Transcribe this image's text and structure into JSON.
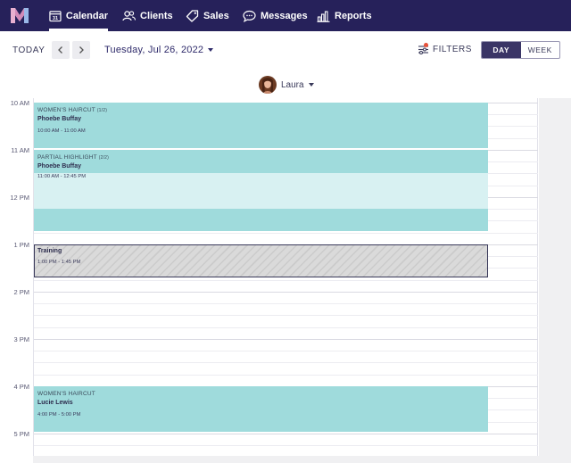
{
  "nav": {
    "items": [
      {
        "label": "Calendar",
        "icon": "calendar-icon",
        "icon_text": "31",
        "active": true
      },
      {
        "label": "Clients",
        "icon": "clients-icon",
        "active": false
      },
      {
        "label": "Sales",
        "icon": "sales-tag-icon",
        "active": false
      },
      {
        "label": "Messages",
        "icon": "messages-icon",
        "active": false
      },
      {
        "label": "Reports",
        "icon": "reports-icon",
        "active": false
      }
    ]
  },
  "toolbar": {
    "today_label": "TODAY",
    "date": "Tuesday, Jul 26, 2022",
    "filters_label": "FILTERS",
    "view_day": "DAY",
    "view_week": "WEEK",
    "active_view": "DAY"
  },
  "staff": {
    "name": "Laura"
  },
  "time_labels": [
    "10 AM",
    "11 AM",
    "12 PM",
    "1 PM",
    "2 PM",
    "3 PM",
    "4 PM",
    "5 PM"
  ],
  "appointments": [
    {
      "service": "WOMEN'S HAIRCUT",
      "count": "(1/2)",
      "client": "Phoebe Buffay",
      "time": "10:00 AM - 11:00 AM"
    },
    {
      "service": "PARTIAL HIGHLIGHT",
      "count": "(2/2)",
      "client": "Phoebe Buffay",
      "time": "11:00 AM - 12:45 PM"
    },
    {
      "service": "WOMEN'S HAIRCUT",
      "count": "",
      "client": "Lucie Lewis",
      "time": "4:00 PM - 5:00 PM"
    }
  ],
  "blocked_time": {
    "title": "Training",
    "time": "1:00 PM - 1:45 PM"
  },
  "colors": {
    "nav_bg": "#26215a",
    "appointment": "#9fdbdc",
    "processing": "#d8f1f2",
    "filters_dot": "#e8513a",
    "active_toggle": "#3a3566"
  }
}
